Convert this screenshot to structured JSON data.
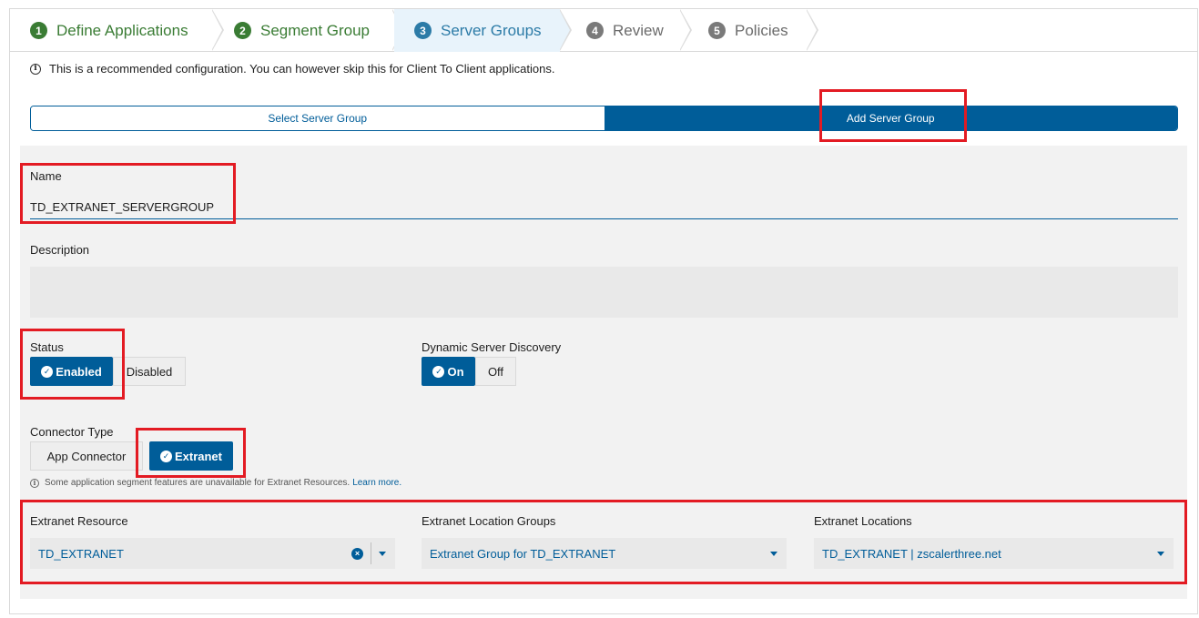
{
  "wizard": {
    "steps": [
      {
        "num": "1",
        "label": "Define Applications"
      },
      {
        "num": "2",
        "label": "Segment Group"
      },
      {
        "num": "3",
        "label": "Server Groups"
      },
      {
        "num": "4",
        "label": "Review"
      },
      {
        "num": "5",
        "label": "Policies"
      }
    ]
  },
  "info": {
    "icon": "info-icon",
    "text": "This is a recommended configuration. You can however skip this for Client To Client applications."
  },
  "mode_toggle": {
    "select_label": "Select Server Group",
    "add_label": "Add Server Group",
    "selected": "Add Server Group"
  },
  "form": {
    "name_label": "Name",
    "name_value": "TD_EXTRANET_SERVERGROUP",
    "description_label": "Description",
    "description_value": "",
    "status_label": "Status",
    "status_enabled": "Enabled",
    "status_disabled": "Disabled",
    "dynamic_label": "Dynamic Server Discovery",
    "dynamic_on": "On",
    "dynamic_off": "Off",
    "connector_label": "Connector Type",
    "connector_app": "App Connector",
    "connector_extranet": "Extranet",
    "extranet_note": "Some application segment features are unavailable for Extranet Resources.",
    "learn_more": "Learn more.",
    "extranet_resource_label": "Extranet Resource",
    "extranet_resource_value": "TD_EXTRANET",
    "location_groups_label": "Extranet Location Groups",
    "location_groups_value": "Extranet Group for TD_EXTRANET",
    "locations_label": "Extranet Locations",
    "locations_value": "TD_EXTRANET | zscalerthree.net"
  },
  "colors": {
    "primary": "#005d99",
    "step_done": "#3a7c34",
    "step_active": "#2c7ba7",
    "highlight": "#e31b23",
    "panel_bg": "#f2f2f2"
  }
}
